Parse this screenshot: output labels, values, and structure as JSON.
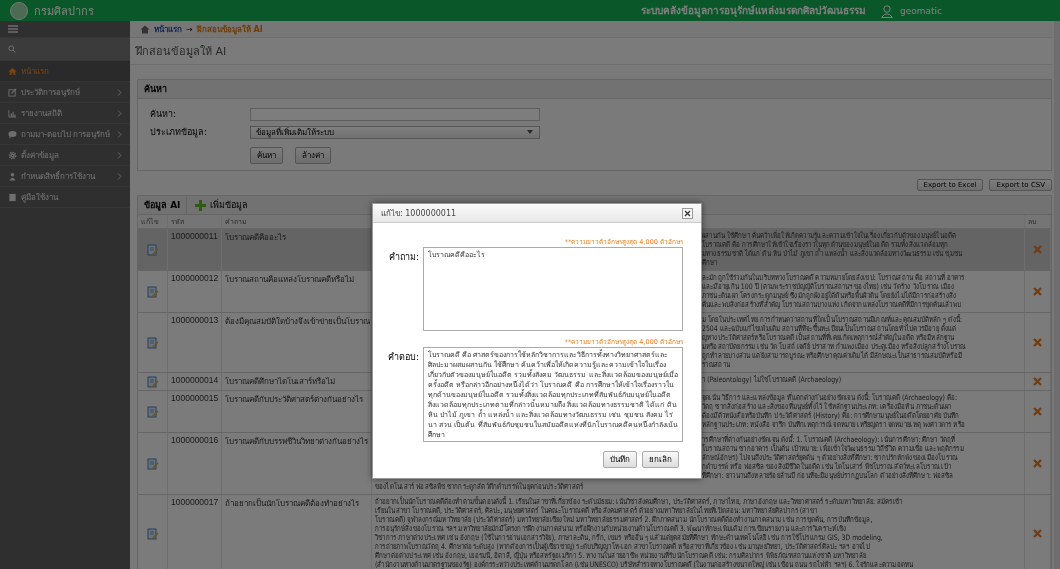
{
  "header": {
    "org_name": "กรมศิลปากร",
    "system_title": "ระบบคลังข้อมูลการอนุรักษ์แหล่งมรดกศิลปวัฒนธรรม",
    "username": "geomatic"
  },
  "sidebar": {
    "items": [
      {
        "label": "หน้าแรก",
        "selected": true,
        "expandable": false
      },
      {
        "label": "ประวัติการอนุรักษ์",
        "selected": false,
        "expandable": true
      },
      {
        "label": "รายงานสถิติ",
        "selected": false,
        "expandable": true
      },
      {
        "label": "ถามมา-ตอบไป การอนุรักษ์",
        "selected": false,
        "expandable": true
      },
      {
        "label": "ตั้งค่าข้อมูล",
        "selected": false,
        "expandable": true
      },
      {
        "label": "กำหนดสิทธิ์การใช้งาน",
        "selected": false,
        "expandable": true
      },
      {
        "label": "คู่มือใช้งาน",
        "selected": false,
        "expandable": false
      }
    ]
  },
  "breadcrumb": {
    "home": "หน้าแรก",
    "separator": "→",
    "current": "ฝึกสอนข้อมูลให้ AI"
  },
  "page_title": "ฝึกสอนข้อมูลให้ AI",
  "search_panel": {
    "title": "ค้นหา",
    "fields": [
      {
        "label": "ค้นหา:",
        "kind": "text"
      },
      {
        "label": "ประเภทข้อมูล:",
        "kind": "select",
        "value": "ข้อมูลที่เพิ่มเติมให้ระบบ"
      }
    ],
    "buttons": [
      "ค้นหา",
      "ล้างค่า"
    ]
  },
  "export_buttons": [
    "Export to Excel",
    "Export to CSV"
  ],
  "table": {
    "tab": "ข้อมูล AI",
    "add_button": "เพิ่มข้อมูล",
    "columns": [
      {
        "label": "แก้ไข",
        "kind": "edit"
      },
      {
        "label": "รหัส",
        "kind": "code"
      },
      {
        "label": "คำถาม",
        "kind": "question"
      },
      {
        "label": "ลบ",
        "kind": "delete"
      }
    ],
    "rows": [
      {
        "code": "1000000011",
        "question": "โบราณคดีคืออะไร",
        "selected": true,
        "answer_right": [
          "ผสานกัน ใช้ศึกษา ค้นคว้าเพื่อให้เกิดความรู้และความเข้าใจในเรื่องเกี่ยวกับตัวของมนุษย์ในอดีต",
          "โบราณคดี คือ การศึกษาให้เข้าใจเรื่องราวในทุกด้านของมนุษย์ในอดีต รวมทั้งสิ่งแวดล้อมทุก",
          "มทางธรรมชาติ ได้แก่ ดิน หิน ป่าไม้ ภูเขา ถ้ำ แหล่งน้ำ และสิ่งแวดล้อมทางวัฒนธรรม เช่น ชุมชน",
          "ศึกษา"
        ]
      },
      {
        "code": "1000000012",
        "question": "โบราณสถานคือแหล่งโบราณคดีหรือไม่",
        "selected": false,
        "answer_right": [
          "ละมักถูกใช้ร่วมกันในบริบททางโบราณคดี ความหมายโดยสังเขป: โบราณสถาน คือ สถานที่ อาคาร",
          "และมีอายุเกิน 100 ปี (ตามพระราชบัญญัติโบราณสถานฯ ของไทย) เช่น วัดร้าง วังโบราณ เมือง",
          "ภาชนะดินเผา โครงกระดูกมนุษย์ ซึ่งมักถูกฝังอยู่ใต้ดินหรือพื้นผิวดิน โดยยังไม่ได้มีการก่อสร้างสิ่ง",
          "ค้นและพบสิ่งก่อสร้างที่สำคัญ โบราณสถานบางแห่ง เกิดจากแหล่งโบราณคดีที่มีการขุดค้นแล้วพบ"
        ]
      },
      {
        "code": "1000000013",
        "question": "ต้องมีคุณสมบัติใดบ้างจึงเข้าข่ายเป็นโบราณ",
        "selected": false,
        "answer_right": [
          "ม โดยในประเทศไทย การกำหนดว่าสถานที่ใดเป็นโบราณสถานมีเกณฑ์และคุณสมบัติหลัก ๆ ดังนี้:",
          "2504 และฉบับแก้ไขเพิ่มเติม สถานที่ที่จะขึ้นทะเบียนเป็นโบราณสถานโดยทั่วไปควรมีอายุ ตั้งแต่",
          "ญทางประวัติศาสตร์หรือโบราณคดี เป็นสถานที่ที่เคยเกิดเหตุการณ์สำคัญในอดีต หรือมีหลักฐาน",
          "มหรือสถาปัตยกรรม เช่น วัด โบสถ์ เจดีย์ ปราสาท กำแพงเมือง ประตูเมือง หรือสิ่งปลูกสร้างโบราณ",
          "ถูกทำลายบางส่วน แต่ยังสามารถบูรณะหรือศึกษาคุณค่าเดิมได้ มีลักษณะเป็นสาธารณสมบัติหรือมี",
          "ราณสถาน"
        ]
      },
      {
        "code": "1000000014",
        "question": "โบราณคดีศึกษาไดโนเสาร์หรือไม่",
        "selected": false,
        "answer_right": [
          "า (Paleontology) ไม่ใช่โบราณคดี (Archaeology)"
        ]
      },
      {
        "code": "1000000015",
        "question": "โบราณคดีกับประวัติศาสตร์ต่างกันอย่างไร",
        "selected": false,
        "answer_right": [
          "จุดเน้น วิธีการ และแหล่งข้อมูล ที่แตกต่างกันอย่างชัดเจน ดังนี้: โบราณคดี (Archaeology) คือ:",
          "วัตถุ ซากสิ่งก่อสร้าง และสิ่งของที่มนุษย์ทิ้งไว้ ใช้หลักฐานประเภท: เครื่องมือหิน ภาชนะดินเผา",
          "ต้องมีตัวหนังสือหรือบันทึก ประวัติศาสตร์ (History) คือ: การศึกษามนุษย์ในอดีตโดยอาศัย บันทึก",
          "หลักฐานประเภท: หนังสือ จารึก บันทึกเหตุการณ์ จดหมาย เหรียญตรา จดหมายเหตุ พงศาวดาร หรือ"
        ]
      },
      {
        "code": "1000000016",
        "question": "โบราณคดีกับบรรพชีวินวิทยาต่างกันอย่างไร",
        "selected": false,
        "answer_right": [
          "ารศึกษาที่ต่างกันอย่างชัดเจน ดังนี้: 1. โบราณคดี (Archaeology): เน้นการศึกษา: ศึกษา วัตถุที่",
          "โบราณสถาน ซากอาคาร เป็นต้น เป้าหมาย: เพื่อเข้าใจวัฒนธรรม วิถีชีวิต ความเชื่อ และพฤติกรรม",
          "ลักษณ์อักษร) ไปจนถึงประวัติศาสตร์ยุคต้น ๆ ตัวอย่างสิ่งที่ศึกษา: ซากปรักหักพังของเมืองโบราณ",
          "กดำบรรพ์ หรือ ฟอสซิล ของสิ่งมีชีวิตในอดีต เช่น ไดโนเสาร์ พืชโบราณ สัตว์ทะเลโบราณ เป้า",
          "ที่ศึกษา: ยาวนานถึงหลายร้อยล้านปี ก่อนที่จะมีมนุษย์ปรากฏบนโลก ตัวอย่างสิ่งที่ศึกษา: ฟอสซิล"
        ],
        "answer_full": [
          "ของไดโนเสาร์ ฟอสซิลพืช ซากกระดูกสัตว์ดึกดำบรรพ์ในยุคก่อนประวัติศาสตร์"
        ]
      },
      {
        "code": "1000000017",
        "question": "ถ้าอยากเป็นนักโบราณคดีต้องทำอย่างไร",
        "selected": false,
        "answer_full": [
          "ถ้าอยากเป็นนักโบราณคดีต้องทำตามขั้นตอนดังนี้ 1. เรียนในสาขาที่เกี่ยวข้อง ระดับมัธยม: เน้นวิชาสังคมศึกษา, ประวัติศาสตร์, ภาษาไทย, ภาษาอังกฤษ และวิทยาศาสตร์ ระดับมหาวิทยาลัย: สมัครเข้า",
          "เรียนในสาขา โบราณคดี, ประวัติศาสตร์, ศิลปะ, มนุษยศาสตร์ ในคณะโบราณคดี หรือสังคมศาสตร์ ตัวอย่างมหาวิทยาลัยในไทยที่เปิดสอน: มหาวิทยาลัยศิลปากร (สาขา",
          "โบราณคดี) จุฬาลงกรณ์มหาวิทยาลัย (ประวัติศาสตร์) มหาวิทยาลัยเชียงใหม่ มหาวิทยาลัยธรรมศาสตร์ 2. ฝึกภาคสนาม นักโบราณคดีต้องทำงานภาคสนาม เช่น การขุดค้น, การบันทึกข้อมูล,",
          "การอนุรักษ์สิ่งของโบราณ ฯลฯ มหาวิทยาลัยมักมีโครงการฝึกงานภาคสนาม หรือฝึกงานกับหน่วยงานด้านโบราณคดี 3. พัฒนาทักษะเพิ่มเติม การเขียนรายงาน และการวิเคราะห์เชิง",
          "วิชาการ ภาษาต่างประเทศ เช่น อังกฤษ (ใช้ในการอ่านเอกสารวิจัย), ภาษาละติน, กรีก, เขมร หรืออื่น ๆ แล้วแต่ยุคสมัยที่ศึกษา ทักษะด้านเทคโนโลยี เช่น การใช้โปรแกรม GIS, 3D modeling,",
          "การถ่ายภาพโบราณวัตถุ 4. ศึกษาต่อระดับสูง (หากต้องการเป็นผู้เชี่ยวชาญ) ระดับปริญญาโท-เอก สาขาโบราณคดี หรือสาขาที่เกี่ยวข้อง เช่น มานุษยวิทยา, ประวัติศาสตร์ศิลปะ ฯลฯ อาจไป",
          "ศึกษาต่อต่างประเทศ เช่น อังกฤษ, เยอรมนี, อิตาลี, ญี่ปุ่น หรือสหรัฐอเมริกา 5. หางานในสายอาชีพ หน่วยงานที่รับนักโบราณคดี เช่น: กรมศิลปากร พิพิธภัณฑสถานแห่งชาติ มหาวิทยาลัย",
          "(สำนักงานทางด้านมาตรฐานของรัฐ) องค์กรระหว่างประเทศด้านมรดกโลก (เช่น UNESCO) บริษัทสำรวจทางโบราณคดี (ในงานก่อสร้างขนาดใหญ่ เช่น เขื่อน ถนน รถไฟฟ้า ฯลฯ) 6. ใจรักและความอดทน"
        ]
      }
    ]
  },
  "modal": {
    "title": "แก้ไข: 1000000011",
    "fields": [
      {
        "label": "คำถาม:",
        "hint": "**ความยาวตัวอักษรสูงสุด 4,000 ตัวอักษร",
        "value": "โบราณคดีคืออะไร"
      },
      {
        "label": "คำตอบ:",
        "hint": "**ความยาวตัวอักษรสูงสุด 4,000 ตัวอักษร",
        "value": "โบราณคดี คือ ศาสตร์ของการใช้หลักวิชาการและวิธีการทั้งทางวิทยาศาสตร์และศิลปะมาผสมผสานกัน ใช้ศึกษา ค้นคว้าเพื่อให้เกิดความรู้และความเข้าใจในเรื่องเกี่ยวกับตัวของมนุษย์ในอดีต รวมทั้งสังคม วัฒนธรรม และสิ่งแวดล้อมของมนุษย์เมื่อครั้งอดีต หรือกล่าวอีกอย่างหนึ่งได้ว่า โบราณคดี คือ การศึกษาให้เข้าใจเรื่องราวในทุกด้านของมนุษย์ในอดีต รวมทั้งสิ่งแวดล้อมทุกประเภทที่สัมพันธ์กับมนุษย์ในอดีต สิ่งแวดล้อมทุกประเภทตามที่กล่าวนั้นหมายถึง สิ่งแวดล้อมทางธรรมชาติ ได้แก่ ดิน หิน ป่าไม้ ภูเขา ถ้ำ แหล่งน้ำ และสิ่งแวดล้อมทางวัฒนธรรม เช่น ชุมชน สังคม ไร่ นา สวน เป็นต้น ที่สัมพันธ์กับชุมชนในสมัยอดีตแห่งที่นักโบราณคดีคนหนึ่งกำลังเน้นศึกษา"
      }
    ],
    "buttons": [
      "บันทึก",
      "ยกเลิก"
    ]
  }
}
